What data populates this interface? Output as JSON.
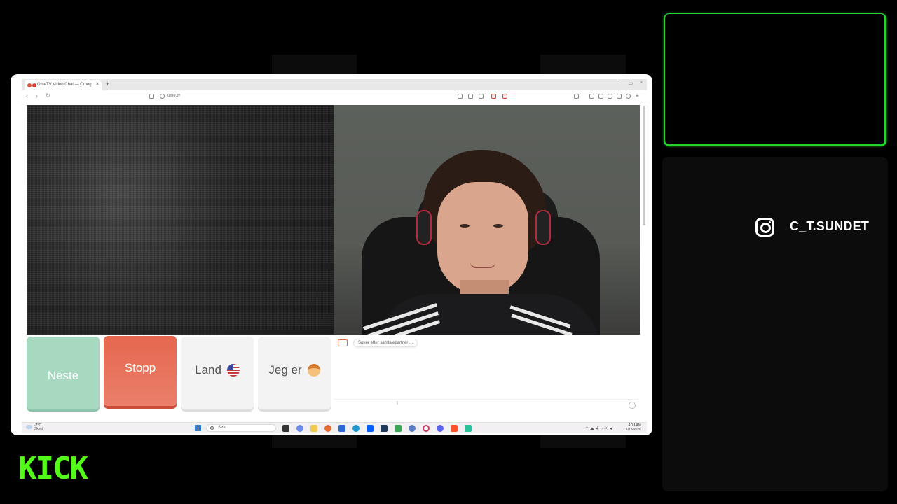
{
  "browser": {
    "tab_title": "OmeTV Video Chat — Omeg",
    "tab_close": "×",
    "new_tab": "+",
    "url": "ome.tv",
    "win_min": "–",
    "win_max": "▭",
    "win_close": "×"
  },
  "controls": {
    "next_label": "Neste",
    "stop_label": "Stopp",
    "country_label": "Land",
    "gender_label": "Jeg er"
  },
  "chat": {
    "status_message": "Søker etter samtalepartner ...",
    "caret": "I"
  },
  "taskbar": {
    "weather_temp": "-7°C",
    "weather_desc": "Skyet",
    "search_placeholder": "Søk",
    "time": "4:14 AM",
    "date": "1/18/2026",
    "tray": "⌃  ☁  ⏚  ◔  ⦿  ◂"
  },
  "overlay": {
    "instagram_handle": "C_T.SUNDET",
    "platform_logo": "KICK",
    "accent_color": "#53fc18"
  }
}
